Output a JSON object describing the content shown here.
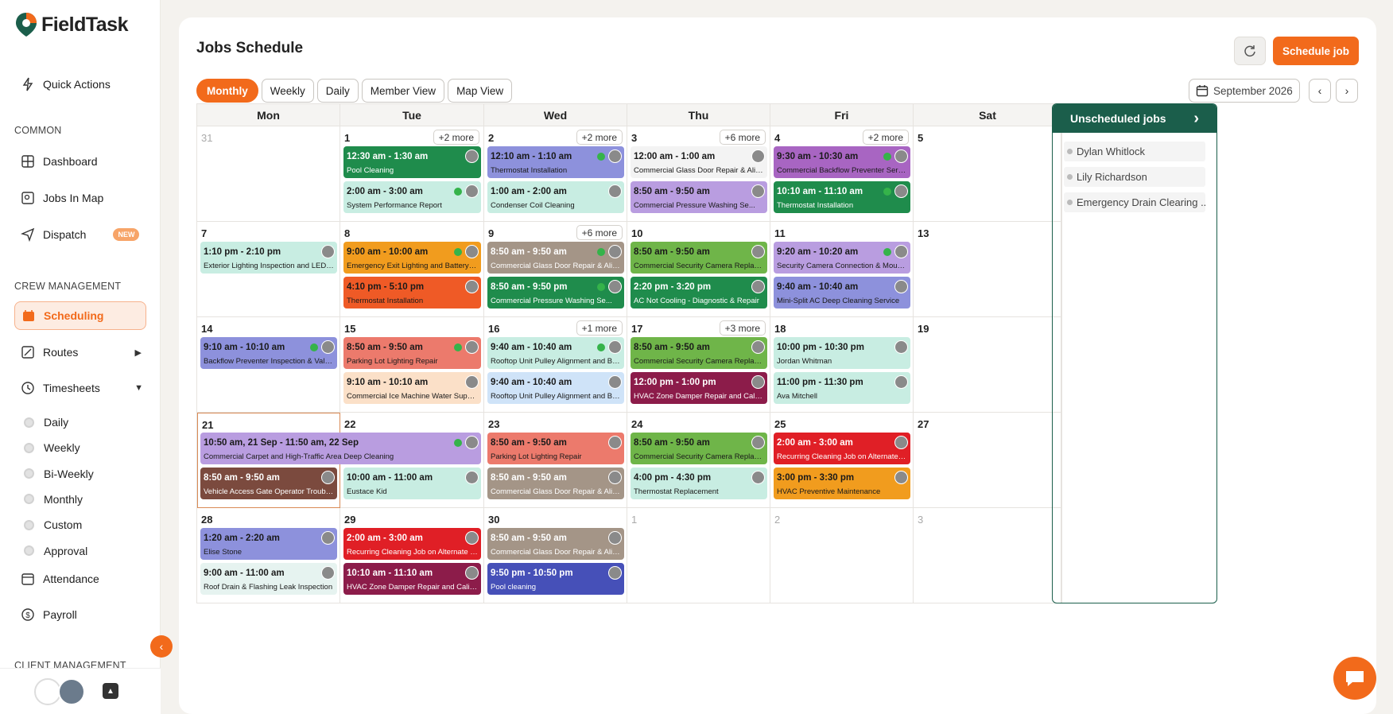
{
  "brand": {
    "name_part1": "Field",
    "name_part2": "Task",
    "accent": "#f26a1b"
  },
  "sidebar": {
    "quick_actions": "Quick Actions",
    "common_label": "COMMON",
    "dashboard": "Dashboard",
    "jobs_in_map": "Jobs In Map",
    "dispatch": "Dispatch",
    "dispatch_badge": "NEW",
    "crew_label": "CREW MANAGEMENT",
    "scheduling": "Scheduling",
    "routes": "Routes",
    "timesheets": "Timesheets",
    "timesheet_items": [
      "Daily",
      "Weekly",
      "Bi-Weekly",
      "Monthly",
      "Custom",
      "Approval"
    ],
    "attendance": "Attendance",
    "payroll": "Payroll",
    "client_label": "CLIENT MANAGEMENT"
  },
  "header": {
    "title": "Jobs Schedule",
    "schedule_button": "Schedule job",
    "month_label": "September 2026"
  },
  "view_tabs": [
    {
      "label": "Monthly",
      "active": true
    },
    {
      "label": "Weekly",
      "active": false
    },
    {
      "label": "Daily",
      "active": false
    },
    {
      "label": "Member View",
      "active": false
    },
    {
      "label": "Map View",
      "active": false
    }
  ],
  "calendar": {
    "day_headers": [
      "Mon",
      "Tue",
      "Wed",
      "Thu",
      "Fri",
      "Sat"
    ],
    "weeks": [
      {
        "days": [
          {
            "num": "31",
            "muted": true
          },
          {
            "num": "1",
            "more": "+2 more"
          },
          {
            "num": "2",
            "more": "+2 more"
          },
          {
            "num": "3",
            "more": "+6 more"
          },
          {
            "num": "4",
            "more": "+2 more"
          },
          {
            "num": "5"
          }
        ],
        "events": [
          {
            "day": 1,
            "slot": 0,
            "span": 1,
            "time": "12:30 am - 1:30 am",
            "name": "Pool Cleaning",
            "color": "#1f8c4c",
            "dark": true,
            "check": false
          },
          {
            "day": 1,
            "slot": 1,
            "span": 1,
            "time": "2:00 am - 3:00 am",
            "name": "System Performance Report",
            "color": "#c8ede2",
            "dark": false,
            "check": true
          },
          {
            "day": 2,
            "slot": 0,
            "span": 1,
            "time": "12:10 am - 1:10 am",
            "name": "Thermostat Installation",
            "color": "#8d91dc",
            "dark": false,
            "check": true
          },
          {
            "day": 2,
            "slot": 1,
            "span": 1,
            "time": "1:00 am - 2:00 am",
            "name": "Condenser Coil Cleaning",
            "color": "#c8ede2",
            "dark": false,
            "check": false
          },
          {
            "day": 3,
            "slot": 0,
            "span": 1,
            "time": "12:00 am - 1:00 am",
            "name": "Commercial Glass Door Repair & Align...",
            "color": "#f3f3f3",
            "dark": false,
            "check": false
          },
          {
            "day": 3,
            "slot": 1,
            "span": 1,
            "time": "8:50 am - 9:50 am",
            "name": "Commercial Pressure Washing Se...",
            "color": "#b99de0",
            "dark": false,
            "check": false
          },
          {
            "day": 4,
            "slot": 0,
            "span": 1,
            "time": "9:30 am - 10:30 am",
            "name": "Commercial Backflow Preventer Service...",
            "color": "#a865c2",
            "dark": false,
            "check": true
          },
          {
            "day": 4,
            "slot": 1,
            "span": 1,
            "time": "10:10 am - 11:10 am",
            "name": "Thermostat Installation",
            "color": "#1f8c4c",
            "dark": true,
            "check": true
          }
        ]
      },
      {
        "days": [
          {
            "num": "7"
          },
          {
            "num": "8"
          },
          {
            "num": "9",
            "more": "+6 more"
          },
          {
            "num": "10"
          },
          {
            "num": "11"
          },
          {
            "num": "13"
          }
        ],
        "events": [
          {
            "day": 0,
            "slot": 0,
            "span": 1,
            "time": "1:10 pm - 2:10 pm",
            "name": "Exterior Lighting Inspection and LED Fix...",
            "color": "#c8ede2",
            "dark": false,
            "check": false
          },
          {
            "day": 1,
            "slot": 0,
            "span": 1,
            "time": "9:00 am - 10:00 am",
            "name": "Emergency Exit Lighting and Battery Ba...",
            "color": "#f19c1e",
            "dark": false,
            "check": true
          },
          {
            "day": 1,
            "slot": 1,
            "span": 1,
            "time": "4:10 pm - 5:10 pm",
            "name": "Thermostat Installation",
            "color": "#ef5a26",
            "dark": false,
            "check": false
          },
          {
            "day": 2,
            "slot": 0,
            "span": 1,
            "time": "8:50 am - 9:50 am",
            "name": "Commercial Glass Door Repair & Align...",
            "color": "#a49587",
            "dark": true,
            "check": true
          },
          {
            "day": 2,
            "slot": 1,
            "span": 1,
            "time": "8:50 am - 9:50 pm",
            "name": "Commercial Pressure Washing Se...",
            "color": "#1f8c4c",
            "dark": true,
            "check": true
          },
          {
            "day": 3,
            "slot": 0,
            "span": 1,
            "time": "8:50 am - 9:50 am",
            "name": "Commercial Security Camera Replace...",
            "color": "#6fb549",
            "dark": false,
            "check": false
          },
          {
            "day": 3,
            "slot": 1,
            "span": 1,
            "time": "2:20 pm - 3:20 pm",
            "name": "AC Not Cooling - Diagnostic & Repair",
            "color": "#1f8c4c",
            "dark": true,
            "check": false
          },
          {
            "day": 4,
            "slot": 0,
            "span": 1,
            "time": "9:20 am - 10:20 am",
            "name": "Security Camera Connection & Mountin...",
            "color": "#b99de0",
            "dark": false,
            "check": true
          },
          {
            "day": 4,
            "slot": 1,
            "span": 1,
            "time": "9:40 am - 10:40 am",
            "name": "Mini-Split AC Deep Cleaning Service",
            "color": "#8d91dc",
            "dark": false,
            "check": false
          }
        ]
      },
      {
        "days": [
          {
            "num": "14"
          },
          {
            "num": "15"
          },
          {
            "num": "16",
            "more": "+1 more"
          },
          {
            "num": "17",
            "more": "+3 more"
          },
          {
            "num": "18"
          },
          {
            "num": "19"
          }
        ],
        "events": [
          {
            "day": 0,
            "slot": 0,
            "span": 1,
            "time": "9:10 am - 10:10 am",
            "name": "Backflow Preventer Inspection & Valve R...",
            "color": "#8d91dc",
            "dark": false,
            "check": true
          },
          {
            "day": 1,
            "slot": 0,
            "span": 1,
            "time": "8:50 am - 9:50 am",
            "name": "Parking Lot Lighting Repair",
            "color": "#ec7a6c",
            "dark": false,
            "check": true
          },
          {
            "day": 1,
            "slot": 1,
            "span": 1,
            "time": "9:10 am - 10:10 am",
            "name": "Commercial Ice Machine Water Supply...",
            "color": "#fbe0c8",
            "dark": false,
            "check": false
          },
          {
            "day": 2,
            "slot": 0,
            "span": 1,
            "time": "9:40 am - 10:40 am",
            "name": "Rooftop Unit Pulley Alignment and Belt ...",
            "color": "#c8ede2",
            "dark": false,
            "check": true
          },
          {
            "day": 2,
            "slot": 1,
            "span": 1,
            "time": "9:40 am - 10:40 am",
            "name": "Rooftop Unit Pulley Alignment and Belt ...",
            "color": "#cfe3f8",
            "dark": false,
            "check": false
          },
          {
            "day": 3,
            "slot": 0,
            "span": 1,
            "time": "8:50 am - 9:50 am",
            "name": "Commercial Security Camera Replace...",
            "color": "#6fb549",
            "dark": false,
            "check": false
          },
          {
            "day": 3,
            "slot": 1,
            "span": 1,
            "time": "12:00 pm - 1:00 pm",
            "name": "HVAC Zone Damper Repair and Calibra...",
            "color": "#8c1c4a",
            "dark": true,
            "check": false
          },
          {
            "day": 4,
            "slot": 0,
            "span": 1,
            "time": "10:00 pm - 10:30 pm",
            "name": "Jordan Whitman",
            "color": "#c8ede2",
            "dark": false,
            "check": false
          },
          {
            "day": 4,
            "slot": 1,
            "span": 1,
            "time": "11:00 pm - 11:30 pm",
            "name": "Ava Mitchell",
            "color": "#c8ede2",
            "dark": false,
            "check": false
          }
        ]
      },
      {
        "days": [
          {
            "num": "21",
            "today": true
          },
          {
            "num": "22"
          },
          {
            "num": "23"
          },
          {
            "num": "24"
          },
          {
            "num": "25"
          },
          {
            "num": "27"
          }
        ],
        "events": [
          {
            "day": 0,
            "slot": 0,
            "span": 2,
            "time": "10:50 am, 21 Sep - 11:50 am, 22 Sep",
            "name": "Commercial Carpet and High-Traffic Area Deep Cleaning",
            "color": "#b99de0",
            "dark": false,
            "check": true
          },
          {
            "day": 0,
            "slot": 1,
            "span": 1,
            "time": "8:50 am - 9:50 am",
            "name": "Vehicle Access Gate Operator Troublesh...",
            "color": "#7b4a3e",
            "dark": true,
            "check": false
          },
          {
            "day": 1,
            "slot": 1,
            "span": 1,
            "time": "10:00 am - 11:00 am",
            "name": "Eustace Kid",
            "color": "#c8ede2",
            "dark": false,
            "check": false
          },
          {
            "day": 2,
            "slot": 0,
            "span": 1,
            "time": "8:50 am - 9:50 am",
            "name": "Parking Lot Lighting Repair",
            "color": "#ec7a6c",
            "dark": false,
            "check": false
          },
          {
            "day": 2,
            "slot": 1,
            "span": 1,
            "time": "8:50 am - 9:50 am",
            "name": "Commercial Glass Door Repair & Align...",
            "color": "#a49587",
            "dark": true,
            "check": false
          },
          {
            "day": 3,
            "slot": 0,
            "span": 1,
            "time": "8:50 am - 9:50 am",
            "name": "Commercial Security Camera Replace...",
            "color": "#6fb549",
            "dark": false,
            "check": false
          },
          {
            "day": 3,
            "slot": 1,
            "span": 1,
            "time": "4:00 pm - 4:30 pm",
            "name": "Thermostat Replacement",
            "color": "#c8ede2",
            "dark": false,
            "check": false
          },
          {
            "day": 4,
            "slot": 0,
            "span": 1,
            "time": "2:00 am - 3:00 am",
            "name": "Recurring Cleaning Job on Alternate Fri...",
            "color": "#e01f26",
            "dark": true,
            "check": false
          },
          {
            "day": 4,
            "slot": 1,
            "span": 1,
            "time": "3:00 pm - 3:30 pm",
            "name": "HVAC Preventive Maintenance",
            "color": "#f19c1e",
            "dark": false,
            "check": false
          }
        ]
      },
      {
        "days": [
          {
            "num": "28"
          },
          {
            "num": "29"
          },
          {
            "num": "30"
          },
          {
            "num": "1",
            "muted": true
          },
          {
            "num": "2",
            "muted": true
          },
          {
            "num": "3",
            "muted": true
          }
        ],
        "events": [
          {
            "day": 0,
            "slot": 0,
            "span": 1,
            "time": "1:20 am - 2:20 am",
            "name": "Elise Stone",
            "color": "#8d91dc",
            "dark": false,
            "check": false
          },
          {
            "day": 0,
            "slot": 1,
            "span": 1,
            "time": "9:00 am - 11:00 am",
            "name": "Roof Drain & Flashing Leak Inspection",
            "color": "#e6f3f0",
            "dark": false,
            "check": false
          },
          {
            "day": 1,
            "slot": 0,
            "span": 1,
            "time": "2:00 am - 3:00 am",
            "name": "Recurring Cleaning Job on Alternate Fri...",
            "color": "#e01f26",
            "dark": true,
            "check": false
          },
          {
            "day": 1,
            "slot": 1,
            "span": 1,
            "time": "10:10 am - 11:10 am",
            "name": "HVAC Zone Damper Repair and Calibra...",
            "color": "#8c1c4a",
            "dark": true,
            "check": false
          },
          {
            "day": 2,
            "slot": 0,
            "span": 1,
            "time": "8:50 am - 9:50 am",
            "name": "Commercial Glass Door Repair & Align...",
            "color": "#a49587",
            "dark": true,
            "check": false
          },
          {
            "day": 2,
            "slot": 1,
            "span": 1,
            "time": "9:50 pm - 10:50 pm",
            "name": "Pool cleaning",
            "color": "#4650b8",
            "dark": true,
            "check": false
          }
        ]
      }
    ]
  },
  "unscheduled": {
    "title": "Unscheduled jobs",
    "items": [
      "Dylan Whitlock",
      "Lily Richardson",
      "Emergency Drain Clearing ..."
    ]
  }
}
